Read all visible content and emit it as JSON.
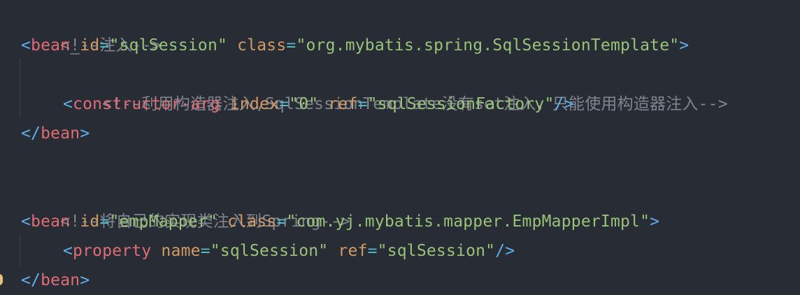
{
  "editor": {
    "theme_colors": {
      "background": "#282c34",
      "comment": "#7f848e",
      "tag": "#e06c75",
      "attribute": "#d19a66",
      "string": "#98c379",
      "bracket": "#61afef"
    },
    "lines": [
      {
        "comment": "<!--注入-->"
      },
      {
        "open": "<",
        "tag": "bean",
        "sep1": "_",
        "attr1": "id",
        "eq1": "=",
        "val1": "\"sqlSession\"",
        "attr2": "class",
        "eq2": "=",
        "val2": "\"org.mybatis.spring.SqlSessionTemplate\"",
        "close": ">"
      },
      {
        "comment": "<!--利用构造器注入,SqlSessionTemplate没有set注入，只能使用构造器注入-->"
      },
      {
        "open": "<",
        "tag": "constructor-arg",
        "attr1": "index",
        "eq1": "=",
        "val1": "\"0\"",
        "attr2": "ref",
        "eq2": "=",
        "val2": "\"sqlSessionFactory\"",
        "close": "/>"
      },
      {
        "open": "</",
        "tag": "bean",
        "close": ">"
      },
      {
        "comment": "<!--将自己的实现类注入到Spring-->"
      },
      {
        "open": "<",
        "tag": "bean",
        "attr1": "id",
        "eq1": "=",
        "val1": "\"empMapper\"",
        "attr2": "class",
        "eq2": "=",
        "val2": "\"com.yj.mybatis.mapper.EmpMapperImpl\"",
        "close": ">"
      },
      {
        "open": "<",
        "tag": "property",
        "attr1": "name",
        "eq1": "=",
        "val1": "\"sqlSession\"",
        "attr2": "ref",
        "eq2": "=",
        "val2": "\"sqlSession\"",
        "close": "/>"
      },
      {
        "open": "</",
        "tag": "bean",
        "close": ">"
      }
    ]
  }
}
